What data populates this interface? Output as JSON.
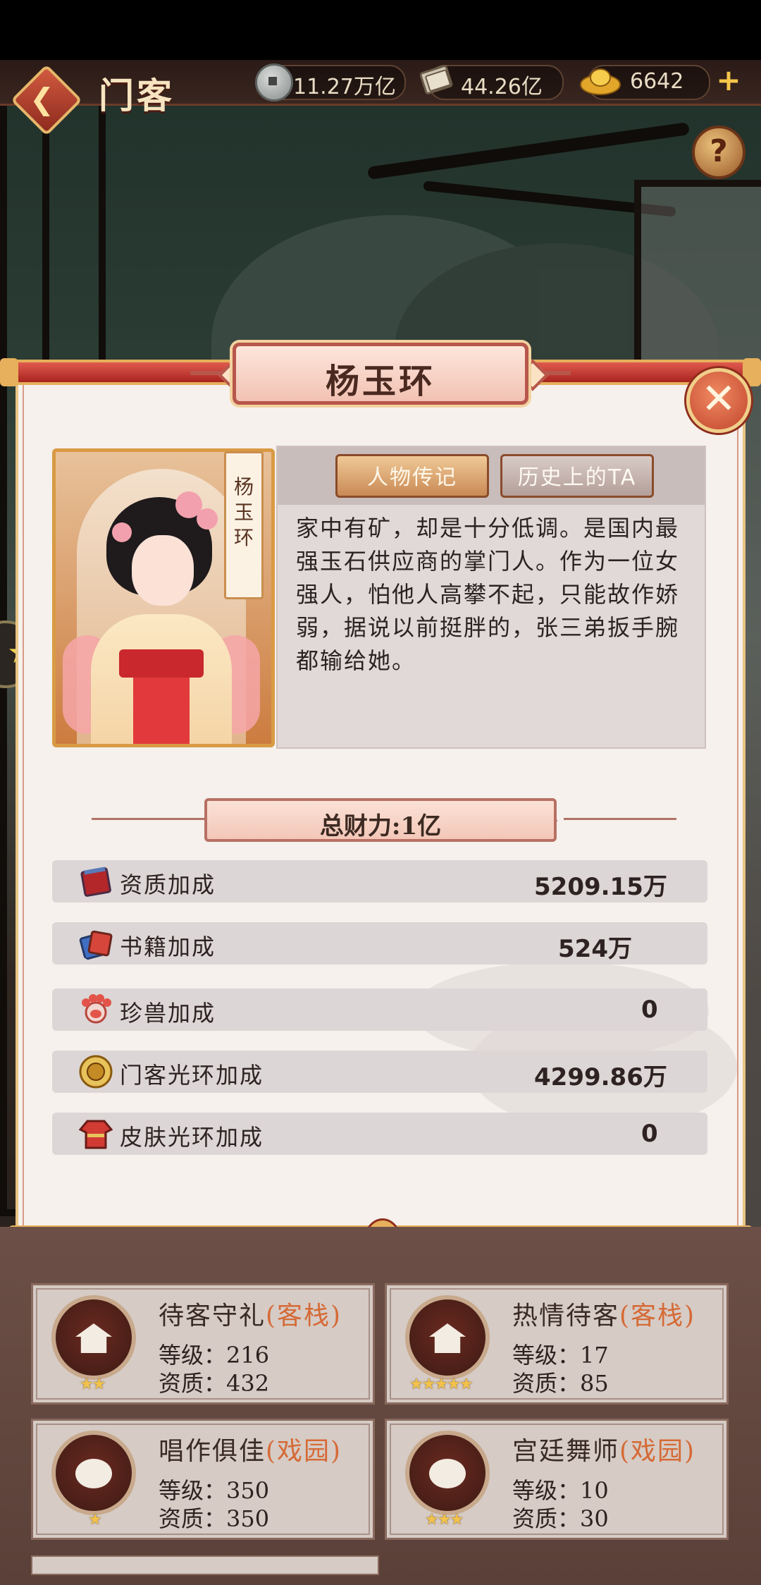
{
  "header": {
    "title": "门客",
    "resources": [
      {
        "icon": "coin-icon",
        "value": "11.27万亿"
      },
      {
        "icon": "book-icon",
        "value": "44.26亿"
      },
      {
        "icon": "gold-ingot-icon",
        "value": "6642"
      }
    ]
  },
  "modal": {
    "name": "杨玉环",
    "name_tag": "杨玉环",
    "tabs": {
      "active": "人物传记",
      "inactive": "历史上的TA"
    },
    "bio": "家中有矿，却是十分低调。是国内最强玉石供应商的掌门人。作为一位女强人，怕他人高攀不起，只能故作娇弱，据说以前挺胖的，张三弟扳手腕都输给她。",
    "total_wealth": "总财力:1亿",
    "stats": [
      {
        "icon": "red-book-icon",
        "label": "资质加成",
        "value": "5209.15万"
      },
      {
        "icon": "blue-books-icon",
        "label": "书籍加成",
        "value": "524万"
      },
      {
        "icon": "paw-icon",
        "label": "珍兽加成",
        "value": "0"
      },
      {
        "icon": "gold-medallion-icon",
        "label": "门客光环加成",
        "value": "4299.86万"
      },
      {
        "icon": "red-robe-icon",
        "label": "皮肤光环加成",
        "value": "0"
      }
    ]
  },
  "cards": [
    {
      "title": "待客守礼",
      "tag": "(客栈)",
      "level_label": "等级：",
      "level": "216",
      "quality_label": "资质：",
      "quality": "432",
      "stars": 2
    },
    {
      "title": "热情待客",
      "tag": "(客栈)",
      "level_label": "等级：",
      "level": "17",
      "quality_label": "资质：",
      "quality": "85",
      "stars": 5
    },
    {
      "title": "唱作俱佳",
      "tag": "(戏园)",
      "level_label": "等级：",
      "level": "350",
      "quality_label": "资质：",
      "quality": "350",
      "stars": 1
    },
    {
      "title": "宫廷舞师",
      "tag": "(戏园)",
      "level_label": "等级：",
      "level": "10",
      "quality_label": "资质：",
      "quality": "30",
      "stars": 3
    }
  ],
  "colors": {
    "accent_red": "#c1452c",
    "gold": "#e6b05c",
    "tag_orange": "#d56a36"
  }
}
